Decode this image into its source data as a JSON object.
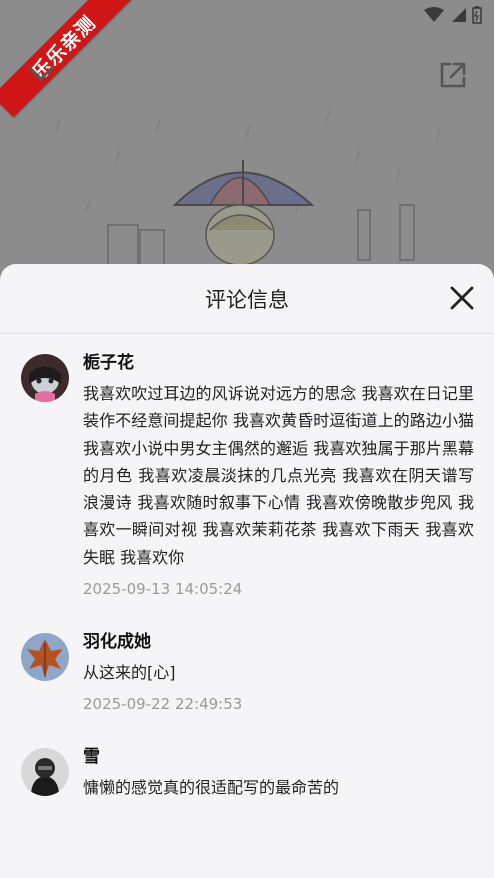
{
  "badge": {
    "text": "乐乐亲测"
  },
  "sheet": {
    "title": "评论信息"
  },
  "comments": [
    {
      "user": "栀子花",
      "text": "我喜欢吹过耳边的风诉说对远方的思念  我喜欢在日记里装作不经意间提起你  我喜欢黄昏时逗街道上的路边小猫    我喜欢小说中男女主偶然的邂逅     我喜欢独属于那片黑幕的月色      我喜欢凌晨淡抹的几点光亮       我喜欢在阴天谱写浪漫诗        我喜欢随时叙事下心情          我喜欢傍晚散步兜风          我喜欢一瞬间对视           我喜欢茉莉花茶           我喜欢下雨天            我喜欢失眠             我喜欢你",
      "time": "2025-09-13 14:05:24"
    },
    {
      "user": "羽化成她",
      "text": "从这来的[心]",
      "time": "2025-09-22 22:49:53"
    },
    {
      "user": "雪",
      "text": "慵懒的感觉真的很适配写的最命苦的",
      "time": ""
    }
  ]
}
